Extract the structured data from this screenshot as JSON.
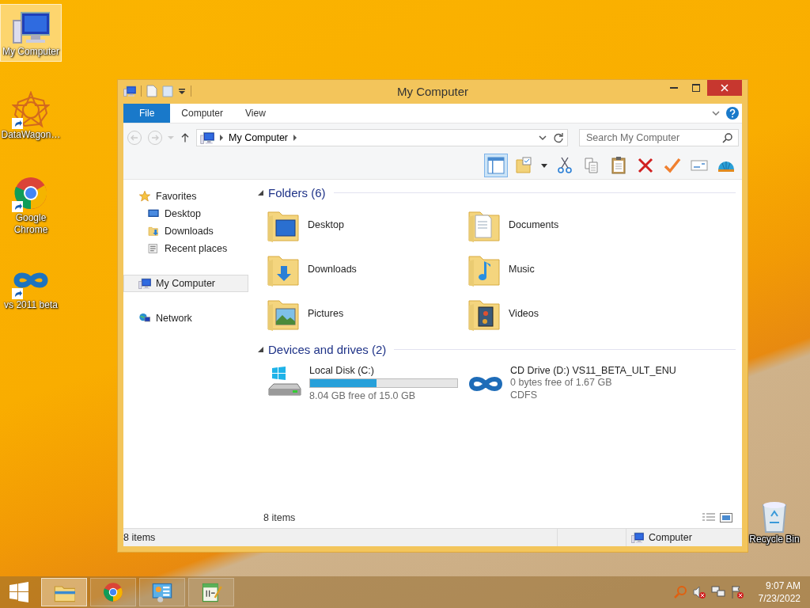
{
  "desktop_icons": [
    {
      "label": "My Computer",
      "kind": "computer",
      "selected": true,
      "shortcut": false
    },
    {
      "label": "DataWagon…",
      "kind": "star",
      "selected": false,
      "shortcut": true
    },
    {
      "label": "Google Chrome",
      "kind": "chrome",
      "selected": false,
      "shortcut": true
    },
    {
      "label": "vs 2011 beta",
      "kind": "infinity",
      "selected": false,
      "shortcut": true
    }
  ],
  "recycle_bin": {
    "label": "Recycle Bin"
  },
  "window": {
    "title": "My Computer",
    "ribbon_tabs": [
      {
        "label": "File",
        "kind": "file"
      },
      {
        "label": "Computer",
        "kind": "tab"
      },
      {
        "label": "View",
        "kind": "tab"
      }
    ],
    "address": {
      "path": "My Computer"
    },
    "search": {
      "placeholder": "Search My Computer"
    },
    "nav_pane": [
      {
        "label": "Favorites",
        "kind": "star",
        "selected": false,
        "children": [
          {
            "label": "Desktop",
            "kind": "desktop",
            "selected": false
          },
          {
            "label": "Downloads",
            "kind": "downloads",
            "selected": false
          },
          {
            "label": "Recent places",
            "kind": "recent",
            "selected": false
          }
        ]
      },
      {
        "label": "My Computer",
        "kind": "computer",
        "selected": true
      },
      {
        "label": "Network",
        "kind": "network",
        "selected": false
      }
    ],
    "sections": [
      {
        "title": "Folders (6)",
        "expanded": true,
        "items": [
          {
            "name": "Desktop",
            "kind": "desktop"
          },
          {
            "name": "Documents",
            "kind": "documents"
          },
          {
            "name": "Downloads",
            "kind": "downloads"
          },
          {
            "name": "Music",
            "kind": "music"
          },
          {
            "name": "Pictures",
            "kind": "pictures"
          },
          {
            "name": "Videos",
            "kind": "videos"
          }
        ]
      },
      {
        "title": "Devices and drives (2)",
        "expanded": true,
        "drives": [
          {
            "name": "Local Disk (C:)",
            "kind": "disk",
            "level": 0.45,
            "info": [
              "8.04 GB free of 15.0 GB"
            ]
          },
          {
            "name": "CD Drive (D:) VS11_BETA_ULT_ENU",
            "kind": "cd",
            "info": [
              "0 bytes free of 1.67 GB",
              "CDFS"
            ]
          }
        ]
      }
    ],
    "pane_status": "8 items",
    "status_bar": {
      "left": "8 items",
      "right": "Computer"
    }
  },
  "taskbar": {
    "apps": [
      {
        "kind": "explorer",
        "selected": true
      },
      {
        "kind": "chrome",
        "selected": false
      },
      {
        "kind": "control",
        "selected": false
      },
      {
        "kind": "notepad",
        "selected": false
      }
    ],
    "time": "9:07 AM",
    "date": "7/23/2022"
  }
}
